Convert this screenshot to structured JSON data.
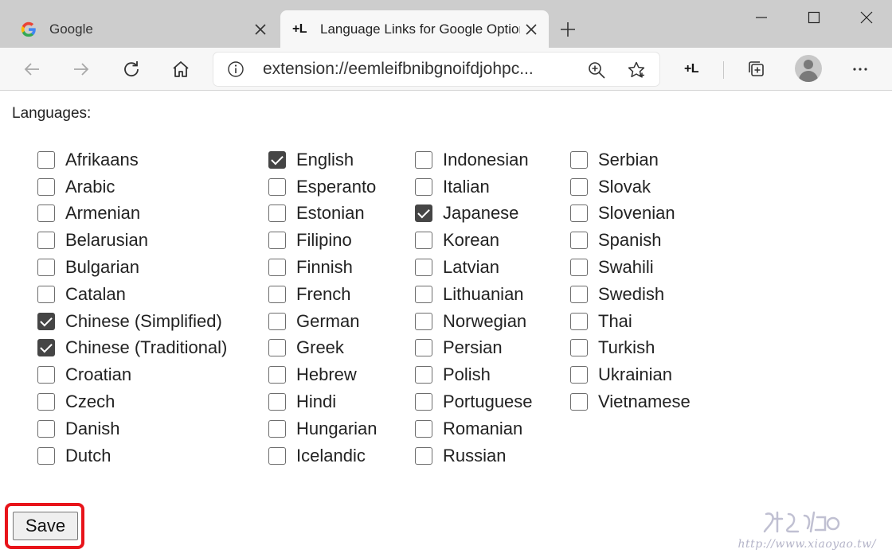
{
  "browser": {
    "tabs": [
      {
        "title": "Google",
        "active": false
      },
      {
        "title": "Language Links for Google Options",
        "active": true
      }
    ],
    "favicon_text": "+L",
    "url": "extension://eemleifbnibgnoifdjohpc...",
    "extension_button_label": "+L"
  },
  "page": {
    "heading": "Languages:",
    "columns": [
      [
        {
          "name": "Afrikaans",
          "checked": false
        },
        {
          "name": "Arabic",
          "checked": false
        },
        {
          "name": "Armenian",
          "checked": false
        },
        {
          "name": "Belarusian",
          "checked": false
        },
        {
          "name": "Bulgarian",
          "checked": false
        },
        {
          "name": "Catalan",
          "checked": false
        },
        {
          "name": "Chinese (Simplified)",
          "checked": true
        },
        {
          "name": "Chinese (Traditional)",
          "checked": true
        },
        {
          "name": "Croatian",
          "checked": false
        },
        {
          "name": "Czech",
          "checked": false
        },
        {
          "name": "Danish",
          "checked": false
        },
        {
          "name": "Dutch",
          "checked": false
        }
      ],
      [
        {
          "name": "English",
          "checked": true
        },
        {
          "name": "Esperanto",
          "checked": false
        },
        {
          "name": "Estonian",
          "checked": false
        },
        {
          "name": "Filipino",
          "checked": false
        },
        {
          "name": "Finnish",
          "checked": false
        },
        {
          "name": "French",
          "checked": false
        },
        {
          "name": "German",
          "checked": false
        },
        {
          "name": "Greek",
          "checked": false
        },
        {
          "name": "Hebrew",
          "checked": false
        },
        {
          "name": "Hindi",
          "checked": false
        },
        {
          "name": "Hungarian",
          "checked": false
        },
        {
          "name": "Icelandic",
          "checked": false
        }
      ],
      [
        {
          "name": "Indonesian",
          "checked": false
        },
        {
          "name": "Italian",
          "checked": false
        },
        {
          "name": "Japanese",
          "checked": true
        },
        {
          "name": "Korean",
          "checked": false
        },
        {
          "name": "Latvian",
          "checked": false
        },
        {
          "name": "Lithuanian",
          "checked": false
        },
        {
          "name": "Norwegian",
          "checked": false
        },
        {
          "name": "Persian",
          "checked": false
        },
        {
          "name": "Polish",
          "checked": false
        },
        {
          "name": "Portuguese",
          "checked": false
        },
        {
          "name": "Romanian",
          "checked": false
        },
        {
          "name": "Russian",
          "checked": false
        }
      ],
      [
        {
          "name": "Serbian",
          "checked": false
        },
        {
          "name": "Slovak",
          "checked": false
        },
        {
          "name": "Slovenian",
          "checked": false
        },
        {
          "name": "Spanish",
          "checked": false
        },
        {
          "name": "Swahili",
          "checked": false
        },
        {
          "name": "Swedish",
          "checked": false
        },
        {
          "name": "Thai",
          "checked": false
        },
        {
          "name": "Turkish",
          "checked": false
        },
        {
          "name": "Ukrainian",
          "checked": false
        },
        {
          "name": "Vietnamese",
          "checked": false
        }
      ]
    ],
    "save_label": "Save"
  },
  "watermark": {
    "text": "http://www.xiaoyao.tw/"
  },
  "colors": {
    "checkbox_checked": "#454545",
    "highlight_border": "#e8141a",
    "tabstrip": "#cdcdcd",
    "toolbar": "#f7f7f7"
  },
  "icons": {
    "google_tab": "google-icon",
    "back": "back-arrow-icon",
    "forward": "forward-arrow-icon",
    "refresh": "refresh-icon",
    "home": "home-icon",
    "info": "info-icon",
    "zoom": "zoom-in-icon",
    "favorite": "star-icon",
    "collections": "collections-icon",
    "profile": "profile-avatar-icon",
    "more": "more-icon"
  }
}
